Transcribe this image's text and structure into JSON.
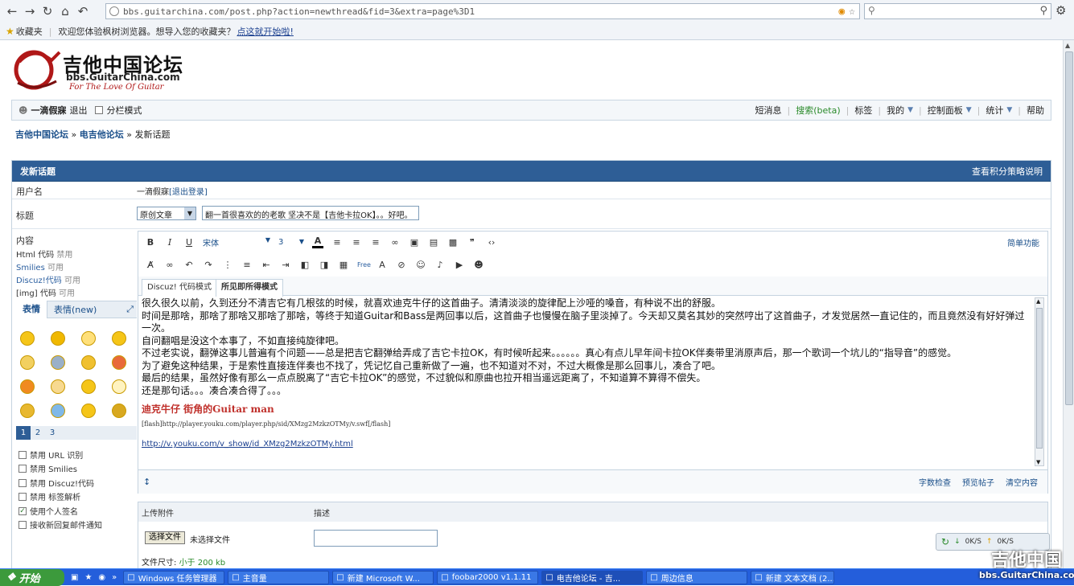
{
  "browser": {
    "url": "bbs.guitarchina.com/post.php?action=newthread&fid=3&extra=page%3D1",
    "bookmarks_label": "收藏夹",
    "bookmark_prompt": "欢迎您体验枫树浏览器。想导入您的收藏夹？",
    "bookmark_link": "点这就开始啦!"
  },
  "logo": {
    "title": "吉他中国论坛",
    "domain": "bbs.GuitarChina.com",
    "slogan": "For The Love Of Guitar"
  },
  "userbar": {
    "username": "一滴假寐",
    "logout": "退出",
    "split_mode": "分栏模式",
    "links": [
      "短消息",
      "搜索(beta)",
      "标签",
      "我的",
      "控制面板",
      "统计",
      "帮助"
    ]
  },
  "breadcrumb": {
    "home": "吉他中国论坛",
    "forum": "电吉他论坛",
    "current": "发新话题",
    "sep": "»"
  },
  "form": {
    "header": "发新话题",
    "header_link": "查看积分策略说明",
    "username_label": "用户名",
    "username_value": "一滴假寐",
    "logout_link": "[退出登录]",
    "subject_label": "标题",
    "type_select": "原创文章",
    "subject_value": "翻一首很喜欢的的老歌 坚决不是【吉他卡拉OK】。。好吧。",
    "content_label": "内容",
    "html_code": "Html 代码",
    "html_state": "禁用",
    "smilies": "Smilies",
    "smilies_state": "可用",
    "discuz_code": "Discuz!代码",
    "discuz_state": "可用",
    "img_code": "[img] 代码",
    "img_state": "可用",
    "smile_tab1": "表情",
    "smile_tab2": "表情(new)",
    "pages": [
      "1",
      "2",
      "3"
    ],
    "options": [
      {
        "label": "禁用 URL 识别",
        "checked": false
      },
      {
        "label": "禁用 Smilies",
        "checked": false
      },
      {
        "label": "禁用 Discuz!代码",
        "checked": false
      },
      {
        "label": "禁用 标签解析",
        "checked": false
      },
      {
        "label": "使用个人签名",
        "checked": true
      },
      {
        "label": "接收新回复邮件通知",
        "checked": false
      }
    ]
  },
  "editor": {
    "font": "宋体",
    "size": "3",
    "simple_mode": "简单功能",
    "mode_code": "Discuz! 代码模式",
    "mode_wysiwyg": "所见即所得模式",
    "lines": [
      "很久很久以前，久到还分不清吉它有几根弦的时候，就喜欢迪克牛仔的这首曲子。清清淡淡的旋律配上沙哑的嗓音，有种说不出的舒服。",
      "时间是那啥，那啥了那啥又那啥了那啥，等终于知道Guitar和Bass是两回事以后，这首曲子也慢慢在脑子里淡掉了。今天却又莫名其妙的突然哼出了这首曲子，才发觉居然一直记住的，而且竟然没有好好弹过一次。",
      "自问翻唱是没这个本事了，不如直接纯旋律吧。",
      "不过老实说，翻弹这事儿普遍有个问题——总是把吉它翻弹给弄成了吉它卡拉OK，有时候听起来。。。。。。真心有点儿早年间卡拉OK伴奏带里消原声后，那一个歌词一个坑儿的“指导音”的感觉。",
      "为了避免这种结果，于是索性直接连伴奏也不找了，凭记忆自己重新做了一遍，也不知道对不对，不过大概像是那么回事儿，凑合了吧。",
      "最后的结果，虽然好像有那么一点点脱离了“吉它卡拉OK”的感觉，不过貌似和原曲也拉开相当遥远距离了，不知道算不算得不偿失。",
      "还是那句话。。。凑合凑合得了。。。"
    ],
    "song_title": "迪克牛仔 街角的Guitar man",
    "flash_code": "[flash]http://player.youku.com/player.php/sid/XMzg2MzkzOTMy/v.swf[/flash]",
    "video_link": "http://v.youku.com/v_show/id_XMzg2MzkzOTMy.html",
    "word_check": "字数检查",
    "preview": "预览帖子",
    "clear": "清空内容"
  },
  "attachments": {
    "upload_label": "上传附件",
    "desc_label": "描述",
    "choose_file": "选择文件",
    "no_file": "未选择文件",
    "size_label": "文件尺寸:",
    "size_value": "小于 200 kb"
  },
  "netwidget": {
    "down": "0K/S",
    "up": "0K/S"
  },
  "taskbar": {
    "start": "开始",
    "tasks": [
      "Windows 任务管理器",
      "主音量",
      "新建 Microsoft W...",
      "foobar2000 v1.1.11",
      "电吉他论坛 - 吉...",
      "周边信息",
      "新建 文本文档 (2..."
    ],
    "watermark_title": "吉他中国",
    "watermark_domain": "bbs.GuitarChina.com"
  }
}
